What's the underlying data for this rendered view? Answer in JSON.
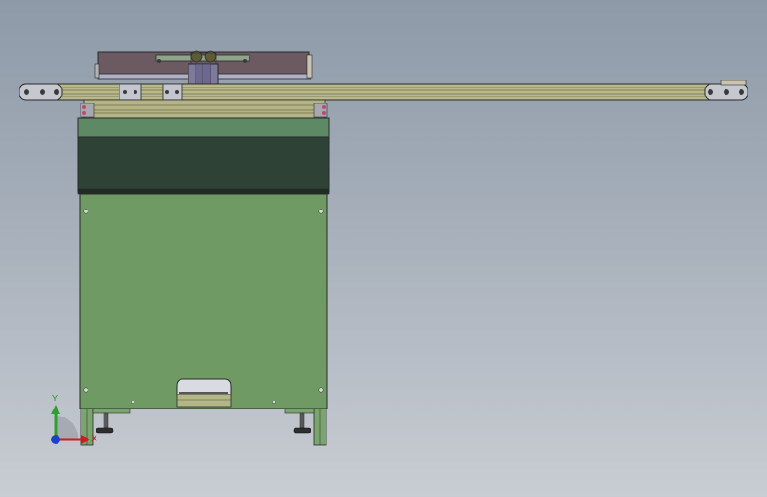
{
  "viewport": {
    "background_top": "#8e9aa8",
    "background_bottom": "#c9cdd3"
  },
  "model": {
    "frame_color": "#6f9a63",
    "belt_color": "#2f4236",
    "rail_color": "#b8b98a",
    "carriage_color": "#7d7a9c"
  },
  "triad": {
    "y_label": "Y",
    "x_label": "X",
    "y_color": "#2fa02f",
    "x_color": "#d01c1c",
    "z_color": "#1c3fd0"
  }
}
